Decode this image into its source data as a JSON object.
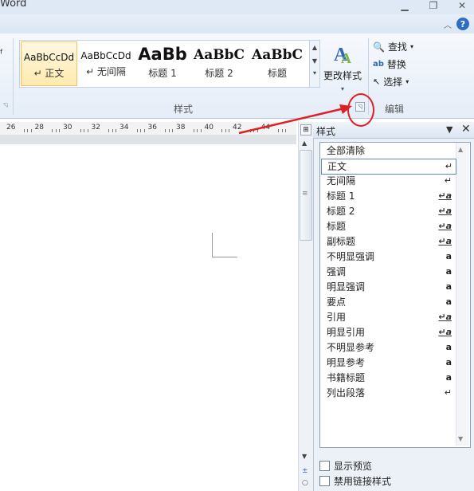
{
  "window": {
    "title": "Word"
  },
  "ribbon": {
    "style_gallery": [
      {
        "sample": "AaBbCcDd",
        "label": "↵ 正文"
      },
      {
        "sample": "AaBbCcDd",
        "label": "↵ 无间隔"
      },
      {
        "sample": "AaBb",
        "label": "标题 1"
      },
      {
        "sample": "AaBbC",
        "label": "标题 2"
      },
      {
        "sample": "AaBbC",
        "label": "标题"
      }
    ],
    "change_style_label": "更改样式",
    "styles_group_label": "样式",
    "edit_group_label": "编辑",
    "edit_commands": [
      "查找",
      "替换",
      "选择"
    ]
  },
  "ruler": {
    "numbers": [
      "26",
      "28",
      "30",
      "32",
      "34",
      "36",
      "38",
      "40",
      "42",
      "44"
    ]
  },
  "styles_pane": {
    "title": "样式",
    "items": [
      {
        "name": "全部清除",
        "indicator": ""
      },
      {
        "name": "正文",
        "indicator": "↵"
      },
      {
        "name": "无间隔",
        "indicator": "↵"
      },
      {
        "name": "标题 1",
        "indicator": "↵a"
      },
      {
        "name": "标题 2",
        "indicator": "↵a"
      },
      {
        "name": "标题",
        "indicator": "↵a"
      },
      {
        "name": "副标题",
        "indicator": "↵a"
      },
      {
        "name": "不明显强调",
        "indicator": "a"
      },
      {
        "name": "强调",
        "indicator": "a"
      },
      {
        "name": "明显强调",
        "indicator": "a"
      },
      {
        "name": "要点",
        "indicator": "a"
      },
      {
        "name": "引用",
        "indicator": "↵a"
      },
      {
        "name": "明显引用",
        "indicator": "↵a"
      },
      {
        "name": "不明显参考",
        "indicator": "a"
      },
      {
        "name": "明显参考",
        "indicator": "a"
      },
      {
        "name": "书籍标题",
        "indicator": "a"
      },
      {
        "name": "列出段落",
        "indicator": "↵"
      }
    ],
    "selected_index": 1,
    "options": [
      "显示预览",
      "禁用链接样式"
    ]
  },
  "annotation_color": "#e01f25"
}
